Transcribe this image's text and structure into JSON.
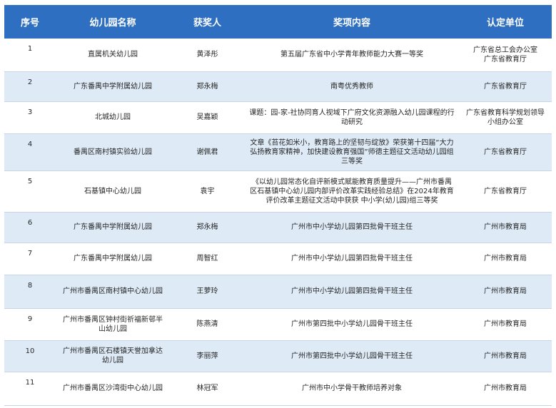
{
  "headers": [
    "序号",
    "幼儿园名称",
    "获奖人",
    "奖项内容",
    "认定单位"
  ],
  "rows": [
    {
      "no": "1",
      "school": "直属机关幼儿园",
      "person": "黄泽彤",
      "award": "第五届广东省中小学青年教师能力大赛一等奖",
      "unit": "广东省总工会办公室\n广东省教育厅"
    },
    {
      "no": "2",
      "school": "广东番禺中学附属幼儿园",
      "person": "郑永梅",
      "award": "南粤优秀教师",
      "unit": "广东省教育厅"
    },
    {
      "no": "3",
      "school": "北城幼儿园",
      "person": "吴嘉颖",
      "award": "课题：园-家-社协同育人视域下广府文化资源融入幼儿园课程的行动研究",
      "unit": "广东省教育科学规划领导小组办公室"
    },
    {
      "no": "4",
      "school": "番禺区南村镇实验幼儿园",
      "person": "谢佩君",
      "award": "文章《苔花如米小，教育路上的坚韧与绽放》荣获第十四届“大力弘扬教育家精神，加快建设教育强国”师德主题征文活动幼儿园组三等奖",
      "unit": "广东省教育厅"
    },
    {
      "no": "5",
      "school": "石基镇中心幼儿园",
      "person": "袁宇",
      "award": "《以幼儿园常态化自评新模式赋能教育质量提升——广州市番禺区石基镇中心幼儿园内部评价改革实践经验总结》在2024年教育评价改革主题征文活动中获获 中小学(幼儿园)组三等奖",
      "unit": "广东省教育厅"
    },
    {
      "no": "6",
      "school": "广东番禺中学附属幼儿园",
      "person": "郑永梅",
      "award": "广州市中小学幼儿园第四批骨干班主任",
      "unit": "广州市教育局"
    },
    {
      "no": "7",
      "school": "广东番禺中学附属幼儿园",
      "person": "周智红",
      "award": "广州市中小学幼儿园第四批骨干班主任",
      "unit": "广州市教育局"
    },
    {
      "no": "8",
      "school": "广州市番禺区南村镇中心幼儿园",
      "person": "王萝玲",
      "award": "广州市中小学幼儿园第四批骨干班主任",
      "unit": "广州市教育局"
    },
    {
      "no": "9",
      "school": "广州市番禺区钟村街祈福新邨半山幼儿园",
      "person": "陈燕清",
      "award": "广州市第四批中小学幼儿园骨干班主任",
      "unit": "广州市教育局"
    },
    {
      "no": "10",
      "school": "广州市番禺区石楼镇天誉加拿达幼儿园",
      "person": "李丽萍",
      "award": "广州市第四批中小学幼儿园骨干班主任",
      "unit": "广州市教育局"
    },
    {
      "no": "11",
      "school": "广州市番禺区沙湾街中心幼儿园",
      "person": "林冠军",
      "award": "广州市中小学骨干教师培养对象",
      "unit": "广州市教育局"
    }
  ],
  "row_heights": [
    46,
    42,
    45,
    52,
    58,
    43,
    45,
    47,
    45,
    44,
    47
  ]
}
